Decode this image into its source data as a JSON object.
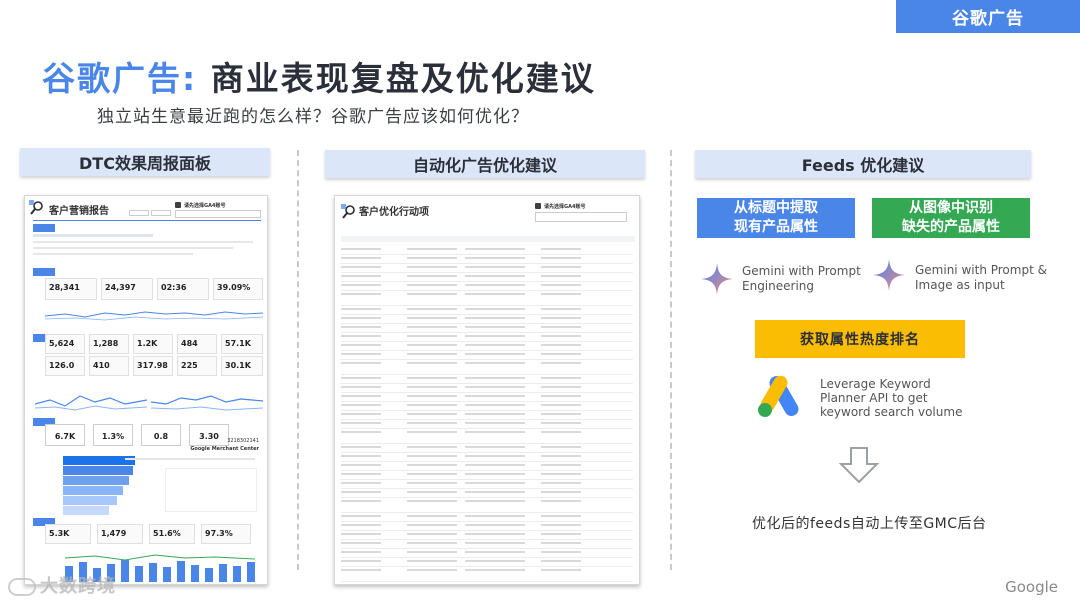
{
  "corner_tag": "谷歌广告",
  "title": {
    "brand": "谷歌广告:",
    "rest": " 商业表现复盘及优化建议"
  },
  "subtitle": "独立站生意最近跑的怎么样？谷歌广告应该如何优化？",
  "columns": {
    "left_header": "DTC效果周报面板",
    "middle_header": "自动化广告优化建议",
    "right_header": "Feeds 优化建议"
  },
  "dashboard": {
    "title": "客户营销报告",
    "account_label": "请先选择GA4账号",
    "kpis_row1": [
      "28,341",
      "24,397",
      "02:36",
      "39.09%"
    ],
    "kpis_row2": [
      "5,624",
      "1,288",
      "1.2K",
      "484",
      "57.1K"
    ],
    "kpis_row3": [
      "126.0",
      "410",
      "317.98",
      "225",
      "30.1K"
    ],
    "gauges": [
      "6.7K",
      "1.3%",
      "0.8",
      "3.30"
    ],
    "id_text": "3218302141",
    "merchant_label": "Google Merchant Center",
    "bottom_kpis": [
      "5.3K",
      "1,479",
      "51.6%",
      "97.3%"
    ],
    "accent": "#4a86e8"
  },
  "action_panel": {
    "title": "客户优化行动项",
    "account_label": "请先选择GA4账号"
  },
  "feeds": {
    "chip_blue": "从标题中提取\n现有产品属性",
    "chip_green": "从图像中识别\n缺失的产品属性",
    "gemini_left": "Gemini with Prompt\nEngineering",
    "gemini_right": "Gemini with Prompt &\nImage as input",
    "yellow_button": "获取属性热度排名",
    "ads_text": "Leverage Keyword\nPlanner API to get\nkeyword search volume",
    "final_text": "优化后的feeds自动上传至GMC后台",
    "colors": {
      "blue": "#4a86e8",
      "green": "#34a853",
      "yellow": "#fbbc04"
    }
  },
  "footer": {
    "google": "Google",
    "watermark": "大数跨境"
  }
}
